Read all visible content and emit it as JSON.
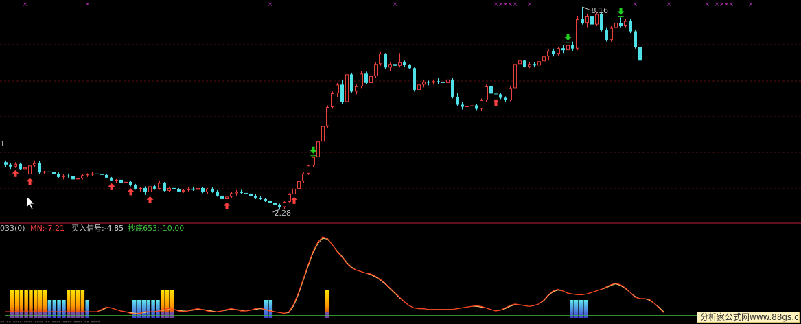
{
  "colors": {
    "background": "#000000",
    "up_candle": "#e8403c",
    "down_candle": "#4fe0e8",
    "divider": "#c0203a",
    "grid": "#5a1010",
    "signal_up": "#ff4040",
    "signal_down": "#20d020",
    "marker": "#c030c0",
    "mn_line": "#ff4020",
    "buy_line": "#f0d070",
    "bottom_line": "#40c040",
    "text_main": "#c0c0c0",
    "label_mn": "#ff4040",
    "label_buy": "#d0d0d0",
    "label_bottom": "#40c040"
  },
  "chart_data": [
    {
      "type": "candlestick",
      "high_label": "8.16",
      "low_label": "2.28",
      "edge_label": "1",
      "ohlc": [
        [
          3.65,
          3.7,
          3.5,
          3.58
        ],
        [
          3.58,
          3.62,
          3.45,
          3.52
        ],
        [
          3.52,
          3.65,
          3.48,
          3.6
        ],
        [
          3.6,
          3.64,
          3.42,
          3.45
        ],
        [
          3.45,
          3.55,
          3.4,
          3.5
        ],
        [
          3.3,
          3.6,
          3.25,
          3.55
        ],
        [
          3.55,
          3.7,
          3.5,
          3.62
        ],
        [
          3.62,
          3.68,
          3.3,
          3.35
        ],
        [
          3.35,
          3.4,
          3.3,
          3.38
        ],
        [
          3.38,
          3.42,
          3.33,
          3.36
        ],
        [
          3.36,
          3.4,
          3.25,
          3.3
        ],
        [
          3.3,
          3.35,
          3.2,
          3.22
        ],
        [
          3.22,
          3.3,
          3.15,
          3.26
        ],
        [
          3.26,
          3.32,
          3.2,
          3.24
        ],
        [
          3.24,
          3.28,
          3.1,
          3.15
        ],
        [
          3.15,
          3.22,
          3.08,
          3.18
        ],
        [
          3.18,
          3.3,
          3.15,
          3.27
        ],
        [
          3.27,
          3.33,
          3.22,
          3.3
        ],
        [
          3.3,
          3.38,
          3.25,
          3.32
        ],
        [
          3.32,
          3.36,
          3.26,
          3.3
        ],
        [
          3.3,
          3.32,
          3.25,
          3.28
        ],
        [
          3.28,
          3.3,
          3.18,
          3.2
        ],
        [
          3.2,
          3.22,
          3.1,
          3.12
        ],
        [
          3.12,
          3.16,
          3.05,
          3.14
        ],
        [
          3.14,
          3.18,
          3.02,
          3.05
        ],
        [
          3.05,
          3.1,
          2.98,
          3.08
        ],
        [
          3.08,
          3.12,
          2.95,
          2.98
        ],
        [
          2.98,
          3.02,
          2.85,
          2.88
        ],
        [
          2.88,
          2.92,
          2.8,
          2.9
        ],
        [
          2.9,
          2.95,
          2.7,
          2.78
        ],
        [
          2.78,
          2.98,
          2.72,
          2.95
        ],
        [
          2.95,
          3.0,
          2.85,
          2.88
        ],
        [
          2.88,
          3.12,
          2.85,
          3.05
        ],
        [
          3.05,
          3.08,
          2.8,
          2.82
        ],
        [
          2.82,
          2.92,
          2.78,
          2.9
        ],
        [
          2.9,
          2.94,
          2.84,
          2.86
        ],
        [
          2.86,
          2.9,
          2.78,
          2.8
        ],
        [
          2.8,
          2.86,
          2.76,
          2.84
        ],
        [
          2.84,
          2.92,
          2.8,
          2.88
        ],
        [
          2.88,
          2.94,
          2.82,
          2.85
        ],
        [
          2.85,
          2.95,
          2.8,
          2.9
        ],
        [
          2.9,
          2.94,
          2.75,
          2.78
        ],
        [
          2.78,
          2.9,
          2.72,
          2.88
        ],
        [
          2.88,
          2.92,
          2.76,
          2.8
        ],
        [
          2.8,
          2.84,
          2.65,
          2.68
        ],
        [
          2.68,
          2.74,
          2.55,
          2.58
        ],
        [
          2.58,
          2.7,
          2.55,
          2.65
        ],
        [
          2.65,
          2.78,
          2.62,
          2.75
        ],
        [
          2.75,
          2.84,
          2.68,
          2.8
        ],
        [
          2.8,
          2.85,
          2.72,
          2.76
        ],
        [
          2.76,
          2.8,
          2.7,
          2.74
        ],
        [
          2.74,
          2.8,
          2.62,
          2.66
        ],
        [
          2.66,
          2.72,
          2.58,
          2.62
        ],
        [
          2.62,
          2.66,
          2.55,
          2.58
        ],
        [
          2.58,
          2.62,
          2.5,
          2.52
        ],
        [
          2.52,
          2.56,
          2.44,
          2.48
        ],
        [
          2.48,
          2.5,
          2.38,
          2.42
        ],
        [
          2.42,
          2.45,
          2.28,
          2.35
        ],
        [
          2.35,
          2.52,
          2.3,
          2.5
        ],
        [
          2.5,
          2.75,
          2.48,
          2.72
        ],
        [
          2.72,
          2.9,
          2.7,
          2.88
        ],
        [
          2.88,
          3.12,
          2.85,
          3.1
        ],
        [
          3.1,
          3.35,
          3.05,
          3.32
        ],
        [
          3.32,
          3.58,
          3.28,
          3.55
        ],
        [
          3.55,
          3.82,
          3.5,
          3.8
        ],
        [
          3.8,
          4.3,
          3.75,
          4.25
        ],
        [
          4.25,
          4.75,
          4.2,
          4.7
        ],
        [
          4.7,
          5.3,
          4.65,
          5.25
        ],
        [
          5.25,
          5.7,
          5.2,
          5.65
        ],
        [
          5.65,
          5.95,
          5.55,
          5.9
        ],
        [
          5.9,
          6.05,
          5.35,
          5.4
        ],
        [
          5.4,
          6.25,
          5.35,
          6.2
        ],
        [
          6.2,
          6.25,
          5.65,
          5.7
        ],
        [
          5.7,
          5.9,
          5.62,
          5.85
        ],
        [
          5.85,
          6.3,
          5.8,
          6.22
        ],
        [
          6.22,
          6.28,
          5.92,
          5.95
        ],
        [
          5.95,
          6.2,
          5.9,
          6.15
        ],
        [
          6.15,
          6.55,
          6.1,
          6.5
        ],
        [
          6.5,
          6.85,
          6.45,
          6.8
        ],
        [
          6.8,
          6.82,
          6.35,
          6.4
        ],
        [
          6.4,
          6.55,
          6.3,
          6.5
        ],
        [
          6.5,
          6.55,
          6.4,
          6.45
        ],
        [
          6.45,
          6.82,
          6.4,
          6.55
        ],
        [
          6.55,
          6.6,
          6.42,
          6.48
        ],
        [
          6.48,
          6.5,
          6.35,
          6.38
        ],
        [
          6.38,
          6.4,
          5.7,
          5.75
        ],
        [
          5.75,
          5.95,
          5.5,
          5.9
        ],
        [
          5.9,
          6.05,
          5.82,
          5.98
        ],
        [
          5.98,
          6.02,
          5.88,
          5.96
        ],
        [
          5.96,
          6.05,
          5.9,
          6.0
        ],
        [
          6.0,
          6.1,
          5.92,
          5.98
        ],
        [
          5.98,
          6.02,
          5.9,
          5.95
        ],
        [
          5.95,
          6.45,
          5.9,
          6.05
        ],
        [
          6.05,
          6.1,
          5.5,
          5.55
        ],
        [
          5.55,
          5.65,
          5.28,
          5.32
        ],
        [
          5.32,
          5.4,
          5.18,
          5.26
        ],
        [
          5.26,
          5.35,
          5.1,
          5.28
        ],
        [
          5.28,
          5.35,
          5.22,
          5.3
        ],
        [
          5.3,
          5.34,
          5.16,
          5.2
        ],
        [
          5.2,
          5.5,
          5.15,
          5.45
        ],
        [
          5.45,
          5.9,
          5.4,
          5.85
        ],
        [
          5.85,
          5.95,
          5.6,
          5.64
        ],
        [
          5.64,
          5.7,
          5.55,
          5.62
        ],
        [
          5.62,
          5.66,
          5.48,
          5.52
        ],
        [
          5.52,
          5.56,
          5.4,
          5.45
        ],
        [
          5.45,
          5.85,
          5.42,
          5.8
        ],
        [
          5.8,
          6.55,
          5.78,
          6.5
        ],
        [
          6.5,
          6.9,
          6.45,
          6.6
        ],
        [
          6.6,
          6.62,
          6.4,
          6.42
        ],
        [
          6.42,
          6.55,
          6.38,
          6.5
        ],
        [
          6.5,
          6.56,
          6.4,
          6.46
        ],
        [
          6.46,
          6.6,
          6.42,
          6.58
        ],
        [
          6.58,
          6.78,
          6.55,
          6.72
        ],
        [
          6.72,
          6.92,
          6.6,
          6.88
        ],
        [
          6.88,
          6.95,
          6.72,
          6.8
        ],
        [
          6.8,
          7.0,
          6.75,
          6.96
        ],
        [
          6.96,
          7.05,
          6.82,
          6.9
        ],
        [
          6.9,
          7.1,
          6.85,
          7.05
        ],
        [
          7.05,
          7.15,
          6.88,
          6.95
        ],
        [
          6.95,
          7.9,
          6.9,
          7.8
        ],
        [
          7.8,
          8.16,
          7.65,
          7.7
        ],
        [
          7.7,
          7.95,
          7.55,
          7.88
        ],
        [
          7.88,
          8.02,
          7.6,
          7.65
        ],
        [
          7.65,
          8.0,
          7.6,
          7.95
        ],
        [
          7.95,
          7.98,
          7.45,
          7.5
        ],
        [
          7.5,
          7.55,
          7.15,
          7.2
        ],
        [
          7.2,
          7.6,
          7.15,
          7.55
        ],
        [
          7.55,
          7.75,
          7.5,
          7.7
        ],
        [
          7.7,
          7.85,
          7.55,
          7.6
        ],
        [
          7.6,
          7.8,
          7.55,
          7.75
        ],
        [
          7.75,
          7.8,
          7.4,
          7.45
        ],
        [
          7.45,
          7.5,
          6.95,
          7.0
        ],
        [
          7.0,
          7.05,
          6.55,
          6.6
        ]
      ],
      "buy_arrow_bars": [
        2,
        5,
        22,
        26,
        30,
        46,
        60,
        102
      ],
      "sell_arrow_bars": [
        64,
        117,
        128
      ],
      "top_marker_bars": [
        4,
        17,
        55,
        81,
        102,
        103,
        104,
        105,
        106,
        109,
        131,
        138,
        146,
        148,
        149,
        150,
        151,
        155
      ]
    },
    {
      "type": "line",
      "header_prefix": "033(0)",
      "series_labels": [
        {
          "name": "MN",
          "label": "MN:-7.21"
        },
        {
          "name": "买入信号",
          "label": "买入信号:-4.85"
        },
        {
          "name": "抄底653",
          "label": "抄底653:-10.00"
        }
      ],
      "mn": [
        0.5,
        0.5,
        0.5,
        0.5,
        0.5,
        0.5,
        0.5,
        0.5,
        0.5,
        0.5,
        0.5,
        0.5,
        0.5,
        0.5,
        0.5,
        0.5,
        0.5,
        0.5,
        0.5,
        0.5,
        0.8,
        1.1,
        1.0,
        0.8,
        0.6,
        0.5,
        0.3,
        0.2,
        0.3,
        0.5,
        0.5,
        0.5,
        0.6,
        0.8,
        0.9,
        0.8,
        0.6,
        0.5,
        0.6,
        0.8,
        0.9,
        0.8,
        0.6,
        0.5,
        0.5,
        0.6,
        0.8,
        0.9,
        0.8,
        0.6,
        0.6,
        0.7,
        0.9,
        1.0,
        0.8,
        0.6,
        0.5,
        0.4,
        0.3,
        0.5,
        1.5,
        3.0,
        4.8,
        6.6,
        8.3,
        9.5,
        10.2,
        10.0,
        9.2,
        8.3,
        7.6,
        6.8,
        6.2,
        5.9,
        5.7,
        5.5,
        5.4,
        5.1,
        4.7,
        4.2,
        3.6,
        3.0,
        2.4,
        1.8,
        1.3,
        1.0,
        0.9,
        0.9,
        0.8,
        0.8,
        0.8,
        0.8,
        0.8,
        0.8,
        0.9,
        1.0,
        1.1,
        1.2,
        1.3,
        1.2,
        1.0,
        0.8,
        0.6,
        0.7,
        1.0,
        1.3,
        1.5,
        1.4,
        1.3,
        1.2,
        1.3,
        1.5,
        2.0,
        2.7,
        3.2,
        3.4,
        3.2,
        2.9,
        2.8,
        2.7,
        2.7,
        2.8,
        3.0,
        3.2,
        3.4,
        3.7,
        4.0,
        4.2,
        4.0,
        3.6,
        3.0,
        2.4,
        2.2,
        2.2,
        2.1,
        1.6,
        1.0,
        0.4
      ],
      "buy_signal": [
        0.5,
        0.5,
        0.5,
        0.5,
        0.5,
        0.5,
        0.5,
        0.5,
        0.5,
        0.5,
        0.5,
        0.5,
        0.5,
        0.5,
        0.5,
        0.5,
        0.5,
        0.5,
        0.5,
        0.5,
        0.7,
        1.0,
        1.0,
        0.8,
        0.6,
        0.5,
        0.4,
        0.3,
        0.3,
        0.4,
        0.5,
        0.5,
        0.6,
        0.7,
        0.8,
        0.8,
        0.7,
        0.6,
        0.6,
        0.7,
        0.8,
        0.8,
        0.7,
        0.6,
        0.5,
        0.6,
        0.7,
        0.8,
        0.8,
        0.7,
        0.6,
        0.7,
        0.8,
        0.9,
        0.8,
        0.7,
        0.5,
        0.4,
        0.3,
        0.4,
        1.3,
        2.8,
        4.6,
        6.4,
        8.1,
        9.3,
        10.0,
        9.9,
        9.2,
        8.4,
        7.7,
        6.9,
        6.3,
        5.9,
        5.7,
        5.5,
        5.3,
        5.0,
        4.6,
        4.1,
        3.5,
        2.9,
        2.3,
        1.8,
        1.3,
        1.0,
        0.9,
        0.9,
        0.8,
        0.8,
        0.8,
        0.8,
        0.8,
        0.8,
        0.9,
        1.0,
        1.1,
        1.2,
        1.2,
        1.1,
        1.0,
        0.8,
        0.6,
        0.7,
        0.9,
        1.2,
        1.4,
        1.4,
        1.3,
        1.2,
        1.3,
        1.5,
        1.9,
        2.6,
        3.1,
        3.3,
        3.2,
        2.9,
        2.8,
        2.7,
        2.7,
        2.8,
        3.0,
        3.2,
        3.4,
        3.6,
        3.9,
        4.1,
        3.9,
        3.5,
        3.0,
        2.5,
        2.2,
        2.2,
        2.0,
        1.6,
        1.1,
        0.5
      ],
      "bottom_653": [
        0,
        0,
        0,
        0,
        0,
        0,
        0,
        0,
        0,
        0,
        0,
        0,
        0,
        0,
        0,
        0,
        0,
        0,
        0,
        0,
        0,
        0,
        0,
        0,
        0,
        0,
        0,
        0,
        0,
        0,
        0,
        0,
        0,
        0,
        0,
        0,
        0,
        0,
        0,
        0,
        0,
        0,
        0,
        0,
        0,
        0,
        0,
        0,
        0,
        0,
        0,
        0,
        0,
        0,
        0,
        0,
        0,
        0,
        0,
        0,
        0,
        0,
        0,
        0,
        0,
        0,
        0,
        0,
        0,
        0,
        0,
        0,
        0,
        0,
        0,
        0,
        0,
        0,
        0,
        0,
        0,
        0,
        0,
        0,
        0,
        0,
        0,
        0,
        0,
        0,
        0,
        0,
        0,
        0,
        0,
        0,
        0,
        0,
        0,
        0,
        0,
        0,
        0,
        0,
        0,
        0,
        0,
        0,
        0,
        0,
        0,
        0,
        0,
        0,
        0,
        0,
        0,
        0,
        0,
        0,
        0,
        0,
        0,
        0,
        0,
        0,
        0,
        0,
        0,
        0,
        0,
        0,
        0,
        0,
        0,
        0,
        0,
        0,
        0,
        0,
        0,
        0,
        0,
        0,
        0,
        0,
        0,
        0
      ],
      "tall_bar_bars": [
        1,
        2,
        3,
        4,
        5,
        6,
        7,
        8,
        13,
        14,
        15,
        16,
        33,
        34,
        35,
        68
      ],
      "short_bar_bars": [
        9,
        10,
        11,
        12,
        17,
        27,
        28,
        29,
        30,
        31,
        32,
        55,
        56,
        120,
        121,
        122,
        123
      ]
    }
  ],
  "watermark": {
    "text": "分析家公式网www.88gs.com"
  },
  "footer": {
    "text": "-- -- ---- ---- ---- -- ---- ---- ---- -- ----"
  }
}
